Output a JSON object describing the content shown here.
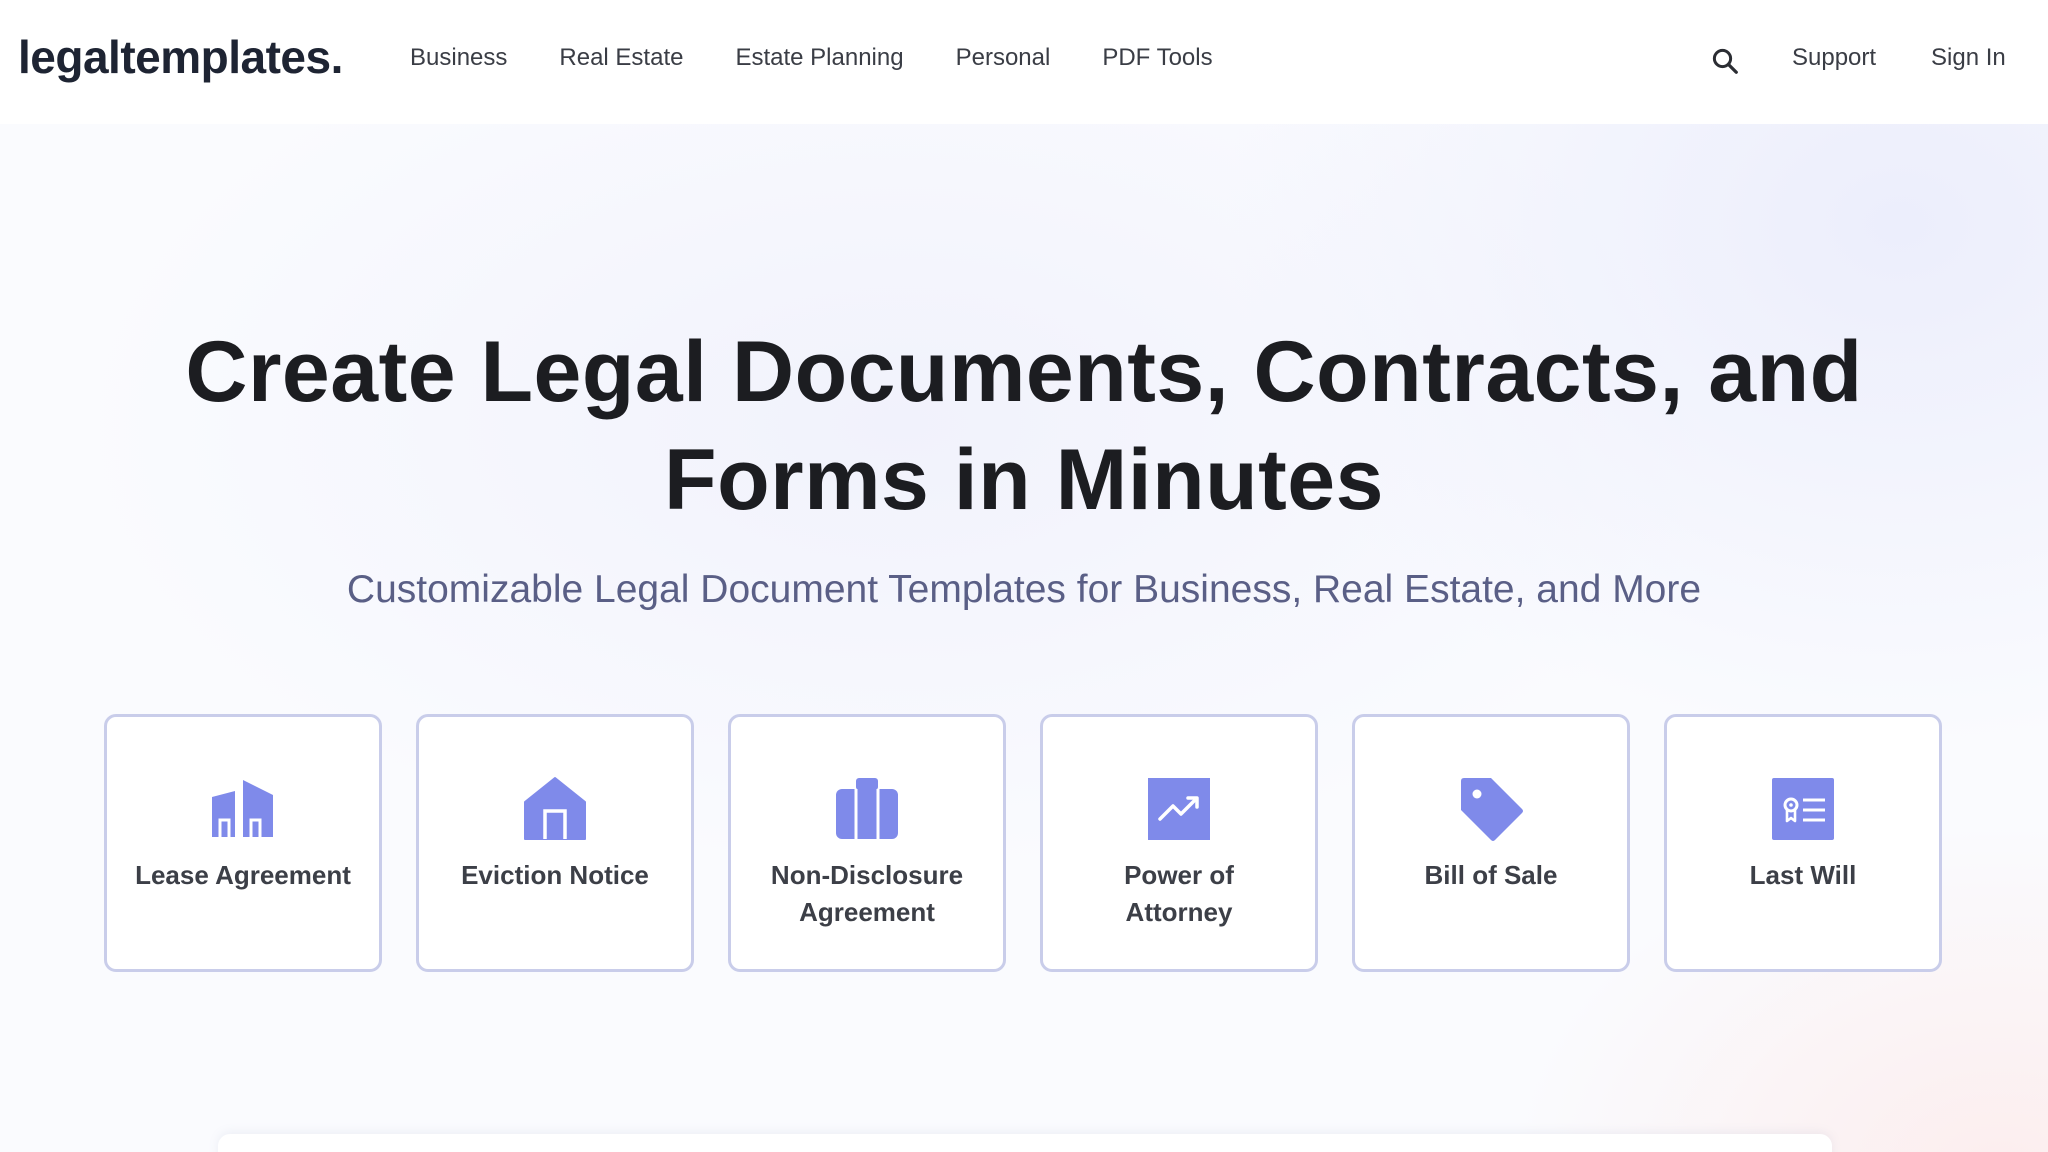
{
  "brand": {
    "logo": "legaltemplates."
  },
  "nav": {
    "items": [
      {
        "label": "Business"
      },
      {
        "label": "Real Estate"
      },
      {
        "label": "Estate Planning"
      },
      {
        "label": "Personal"
      },
      {
        "label": "PDF Tools"
      }
    ],
    "support": "Support",
    "sign_in": "Sign In"
  },
  "hero": {
    "headline_line1": "Create Legal Documents, Contracts, and",
    "headline_line2": "Forms in Minutes",
    "subheadline": "Customizable Legal Document Templates for Business, Real Estate, and More"
  },
  "cards": [
    {
      "label": "Lease Agreement",
      "icon": "buildings-icon"
    },
    {
      "label": "Eviction Notice",
      "icon": "house-icon"
    },
    {
      "label": "Non-Disclosure Agreement",
      "icon": "briefcase-icon"
    },
    {
      "label": "Power of Attorney",
      "icon": "trending-up-icon"
    },
    {
      "label": "Bill of Sale",
      "icon": "price-tag-icon"
    },
    {
      "label": "Last Will",
      "icon": "certificate-icon"
    }
  ],
  "colors": {
    "accent": "#7f8aea",
    "card_border": "#c9cdea",
    "subhead": "#5a5f86",
    "headline": "#1c1d21"
  }
}
